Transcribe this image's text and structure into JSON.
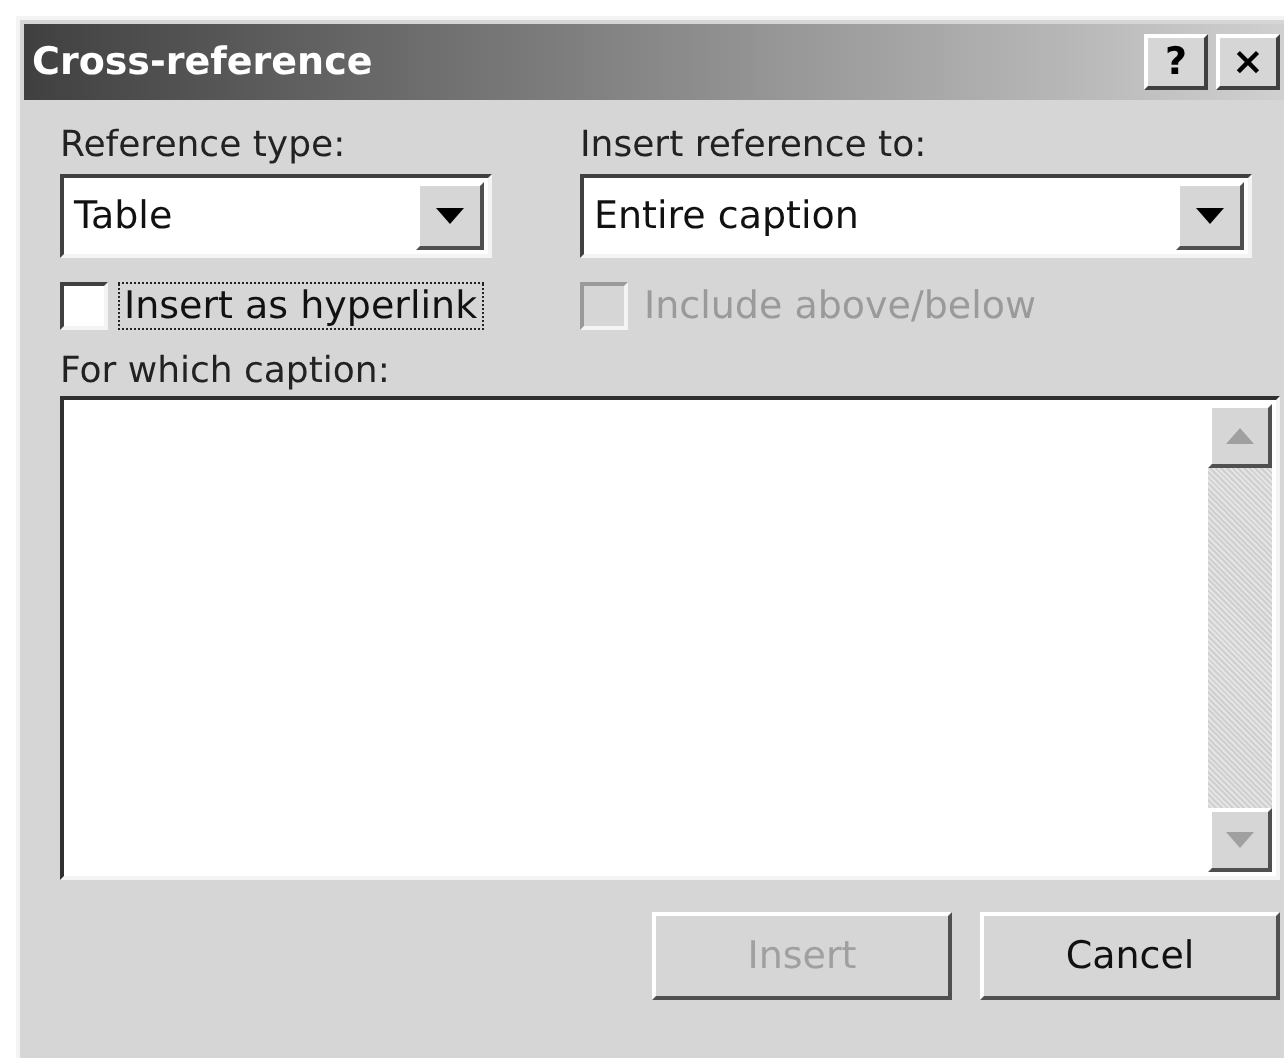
{
  "window": {
    "title": "Cross-reference",
    "title_buttons": [
      "?",
      "×"
    ]
  },
  "reference_type": {
    "label": "Reference type:",
    "value": "Table"
  },
  "insert_reference_to": {
    "label": "Insert reference to:",
    "value": "Entire caption"
  },
  "options": [
    {
      "label": "Insert as hyperlink",
      "checked": false,
      "disabled": false,
      "focused": true
    },
    {
      "label": "Include above/below",
      "checked": false,
      "disabled": true,
      "focused": false
    }
  ],
  "caption_list": {
    "label": "For which caption:"
  },
  "buttons": [
    {
      "label": "Insert",
      "disabled": true
    },
    {
      "label": "Cancel",
      "disabled": false
    }
  ]
}
